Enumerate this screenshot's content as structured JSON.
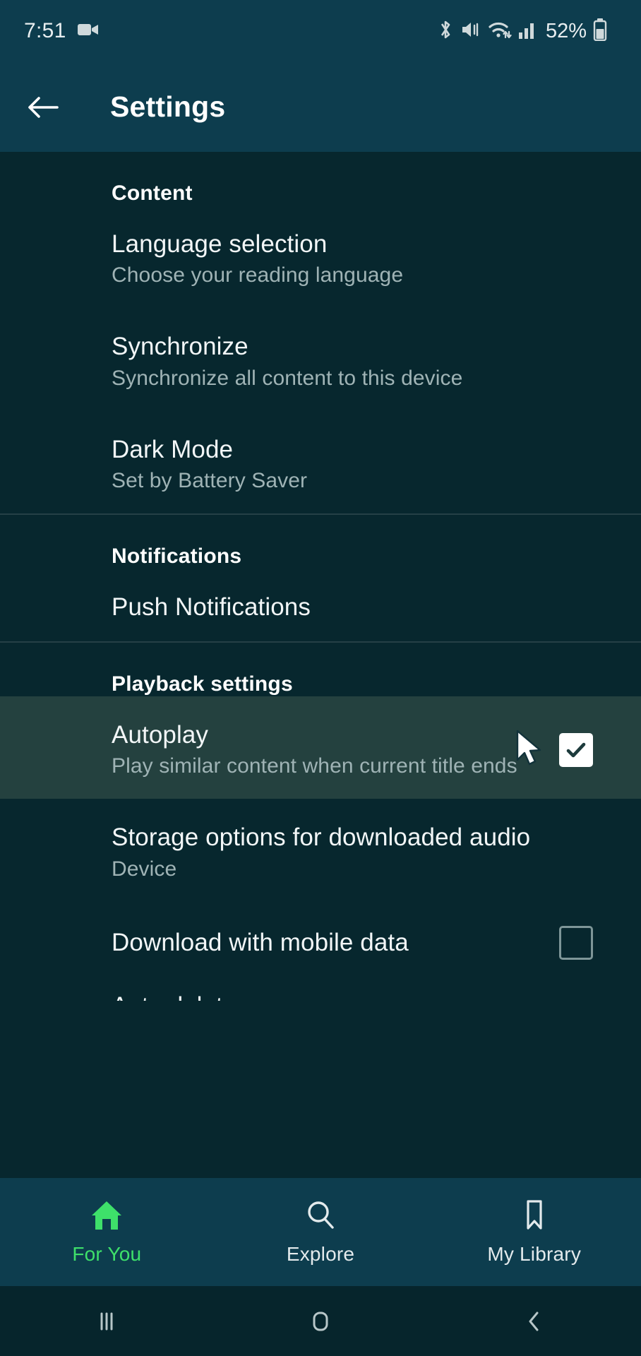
{
  "status_bar": {
    "time": "7:51",
    "battery_percent": "52%",
    "icons": [
      "video-camera-icon",
      "bluetooth-icon",
      "vibrate-icon",
      "wifi-icon",
      "cellular-signal-icon",
      "battery-icon"
    ]
  },
  "app_bar": {
    "back_label": "back-arrow",
    "title": "Settings"
  },
  "sections": [
    {
      "title": "Content",
      "rows": [
        {
          "title": "Language selection",
          "subtitle": "Choose your reading language",
          "control": "none"
        },
        {
          "title": "Synchronize",
          "subtitle": "Synchronize all content to this device",
          "control": "none"
        },
        {
          "title": "Dark Mode",
          "subtitle": "Set by Battery Saver",
          "control": "none"
        }
      ]
    },
    {
      "title": "Notifications",
      "rows": [
        {
          "title": "Push Notifications",
          "subtitle": "",
          "control": "none"
        }
      ]
    },
    {
      "title": "Playback settings",
      "rows": [
        {
          "title": "Autoplay",
          "subtitle": "Play similar content when current title ends",
          "control": "checkbox",
          "checked": true,
          "highlighted": true
        },
        {
          "title": "Storage options for downloaded audio",
          "subtitle": "Device",
          "control": "none"
        },
        {
          "title": "Download with mobile data",
          "subtitle": "",
          "control": "checkbox",
          "checked": false
        }
      ]
    }
  ],
  "clipped_row_text": "Auto delete",
  "bottom_nav": {
    "items": [
      {
        "label": "For You",
        "icon": "home-icon",
        "active": true
      },
      {
        "label": "Explore",
        "icon": "search-icon",
        "active": false
      },
      {
        "label": "My Library",
        "icon": "bookmark-icon",
        "active": false
      }
    ]
  },
  "system_nav": {
    "recents": "recents-icon",
    "home": "home-square-icon",
    "back": "back-chevron-icon"
  },
  "colors": {
    "app_bar": "#0d3d4e",
    "content_bg": "#07272e",
    "highlight_row": "#24413f",
    "accent_green": "#3ee06a",
    "subtitle": "#9fb3b5"
  }
}
